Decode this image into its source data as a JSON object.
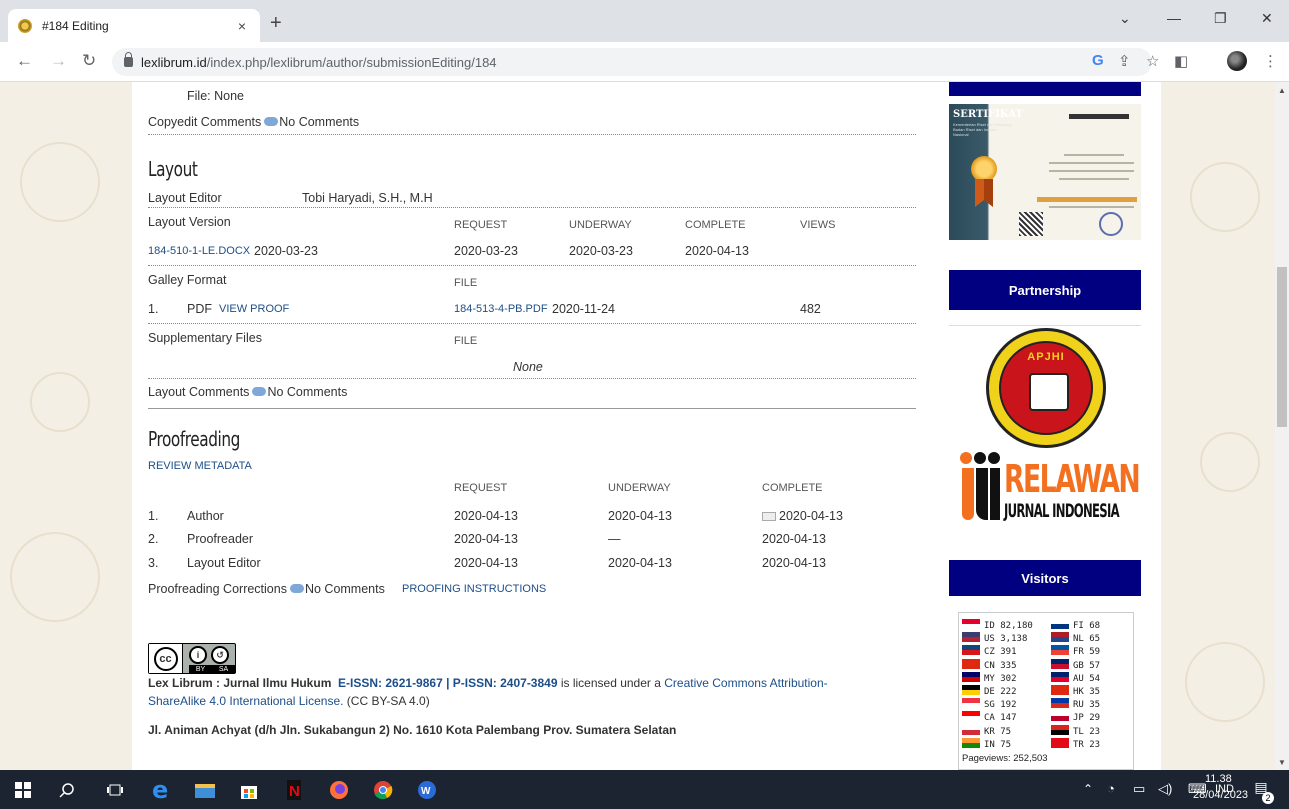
{
  "browser": {
    "tab_title": "#184 Editing",
    "tab_close": "×",
    "new_tab": "+",
    "url_host": "lexlibrum.id",
    "url_path": "/index.php/lexlibrum/author/submissionEditing/184",
    "win_min": "—",
    "win_max": "❐",
    "win_close": "✕",
    "win_chevron": "⌄"
  },
  "copyedit": {
    "file_label": "File: None",
    "comments_label": "Copyedit Comments",
    "comments_value": "No Comments"
  },
  "layout": {
    "heading": "Layout",
    "editor_label": "Layout Editor",
    "editor_name": "Tobi Haryadi, S.H., M.H",
    "version_label": "Layout Version",
    "col_request": "REQUEST",
    "col_underway": "UNDERWAY",
    "col_complete": "COMPLETE",
    "col_views": "VIEWS",
    "version_file": "184-510-1-LE.DOCX",
    "version_date": "2020-03-23",
    "request_date": "2020-03-23",
    "underway_date": "2020-03-23",
    "complete_date": "2020-04-13",
    "galley_label": "Galley Format",
    "col_file": "FILE",
    "galley_num": "1.",
    "galley_type": "PDF",
    "view_proof": "VIEW PROOF",
    "galley_file": "184-513-4-PB.PDF",
    "galley_date": "2020-11-24",
    "galley_views": "482",
    "supp_label": "Supplementary Files",
    "supp_col_file": "FILE",
    "supp_none": "None",
    "comments_label": "Layout Comments",
    "comments_value": "No Comments"
  },
  "proofreading": {
    "heading": "Proofreading",
    "review_metadata": "REVIEW METADATA",
    "col_request": "REQUEST",
    "col_underway": "UNDERWAY",
    "col_complete": "COMPLETE",
    "rows": [
      {
        "num": "1.",
        "role": "Author",
        "request": "2020-04-13",
        "underway": "2020-04-13",
        "complete": "2020-04-13"
      },
      {
        "num": "2.",
        "role": "Proofreader",
        "request": "2020-04-13",
        "underway": "—",
        "complete": "2020-04-13"
      },
      {
        "num": "3.",
        "role": "Layout Editor",
        "request": "2020-04-13",
        "underway": "2020-04-13",
        "complete": "2020-04-13"
      }
    ],
    "corrections_label": "Proofreading Corrections",
    "corrections_value": "No Comments",
    "instructions": "PROOFING INSTRUCTIONS"
  },
  "footer": {
    "journal": "Lex Librum : Jurnal Ilmu Hukum",
    "issn": "E-ISSN: 2621-9867 | P-ISSN: 2407-3849",
    "licensed": " is licensed under a ",
    "license_link1": "Creative Commons Attribution-",
    "license_link2": "ShareAlike 4.0 International License.",
    "license_abbr": " (CC BY-SA 4.0)",
    "address": "Jl. Animan Achyat (d/h Jln. Sukabangun 2) No. 1610 Kota Palembang Prov. Sumatera Selatan",
    "cc_by": "BY",
    "cc_sa": "SA"
  },
  "sidebar": {
    "cert_title": "SERTIFIKAT",
    "cert_sub": "Kementerian Riset dan Teknologi Badan Riset dan Inovasi Nasional",
    "partnership": "Partnership",
    "apjhi": "APJHI",
    "rji_word": "RELAWAN",
    "rji_sub": "JURNAL INDONESIA",
    "visitors": "Visitors",
    "flags_left": [
      {
        "code": "ID",
        "count": "82,180",
        "c1": "#e4002b",
        "c2": "#ffffff"
      },
      {
        "code": "US",
        "count": "3,138",
        "c1": "#3c3b6e",
        "c2": "#b22234"
      },
      {
        "code": "CZ",
        "count": "391",
        "c1": "#11457e",
        "c2": "#d7141a"
      },
      {
        "code": "CN",
        "count": "335",
        "c1": "#de2910",
        "c2": "#de2910"
      },
      {
        "code": "MY",
        "count": "302",
        "c1": "#010066",
        "c2": "#cc0001"
      },
      {
        "code": "DE",
        "count": "222",
        "c1": "#000000",
        "c2": "#ffce00"
      },
      {
        "code": "SG",
        "count": "192",
        "c1": "#ef3340",
        "c2": "#ffffff"
      },
      {
        "code": "CA",
        "count": "147",
        "c1": "#ff0000",
        "c2": "#ffffff"
      },
      {
        "code": "KR",
        "count": "75",
        "c1": "#ffffff",
        "c2": "#cd2e3a"
      },
      {
        "code": "IN",
        "count": "75",
        "c1": "#ff9933",
        "c2": "#138808"
      }
    ],
    "flags_right": [
      {
        "code": "FI",
        "count": "68",
        "c1": "#ffffff",
        "c2": "#003580"
      },
      {
        "code": "NL",
        "count": "65",
        "c1": "#ae1c28",
        "c2": "#21468b"
      },
      {
        "code": "FR",
        "count": "59",
        "c1": "#0055a4",
        "c2": "#ef4135"
      },
      {
        "code": "GB",
        "count": "57",
        "c1": "#012169",
        "c2": "#c8102e"
      },
      {
        "code": "AU",
        "count": "54",
        "c1": "#012169",
        "c2": "#e4002b"
      },
      {
        "code": "HK",
        "count": "35",
        "c1": "#de2910",
        "c2": "#de2910"
      },
      {
        "code": "RU",
        "count": "35",
        "c1": "#0039a6",
        "c2": "#d52b1e"
      },
      {
        "code": "JP",
        "count": "29",
        "c1": "#ffffff",
        "c2": "#bc002d"
      },
      {
        "code": "TL",
        "count": "23",
        "c1": "#dc241f",
        "c2": "#000000"
      },
      {
        "code": "TR",
        "count": "23",
        "c1": "#e30a17",
        "c2": "#e30a17"
      }
    ],
    "pageviews": "Pageviews: 252,503"
  },
  "taskbar": {
    "lang": "IND",
    "time": "11.38",
    "date": "28/04/2023",
    "notif": "2"
  },
  "colors": {
    "sidebar_title_bg": "#000080",
    "link": "#1d4e89",
    "taskbar_bg": "#1b2430"
  }
}
